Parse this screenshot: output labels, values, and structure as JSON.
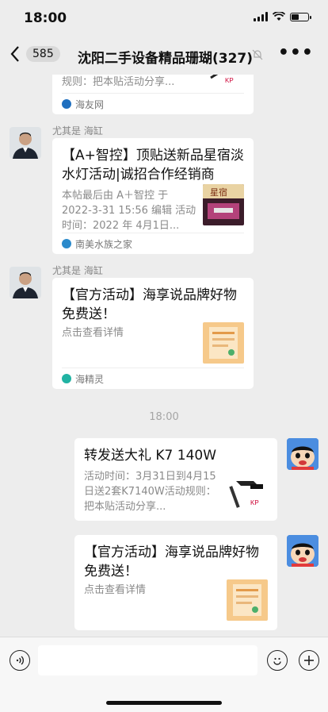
{
  "status_bar": {
    "time": "18:00"
  },
  "nav": {
    "back_icon": "chevron-left-icon",
    "unread_count": "585",
    "title": "沈阳二手设备精品珊瑚(327)",
    "mute_icon": "bell-off-icon",
    "more": "•••"
  },
  "messages": [
    {
      "side": "left",
      "partial": true,
      "desc": "规则：把本贴活动分享...",
      "source": "海友网"
    },
    {
      "side": "left",
      "sender": "尤其是 海缸",
      "title": "【A+智控】顶贴送新品星宿淡水灯活动|诚招合作经销商",
      "desc": "本帖最后由 A＋智控 于 2022-3-31 15:56 编辑 活动时间：2022 年 4月1日...",
      "thumb_text": "星宿",
      "source": "南美水族之家"
    },
    {
      "side": "left",
      "sender": "尤其是 海缸",
      "title": "【官方活动】海享说品牌好物免费送！",
      "desc": "点击查看详情",
      "source": "海精灵"
    },
    {
      "timestamp": "18:00"
    },
    {
      "side": "right",
      "title": "转发送大礼 K7 140W",
      "desc": "活动时间：3月31日到4月15日送2套K7140W活动规则：把本贴活动分享..."
    },
    {
      "side": "right",
      "title": "【官方活动】海享说品牌好物免费送！",
      "desc": "点击查看详情"
    }
  ],
  "input_bar": {
    "placeholder": "",
    "voice_icon": "voice-icon",
    "emoji_icon": "emoji-icon",
    "plus_icon": "plus-icon"
  },
  "colors": {
    "background": "#ededed",
    "card": "#ffffff",
    "muted_text": "#8a8a8a"
  }
}
